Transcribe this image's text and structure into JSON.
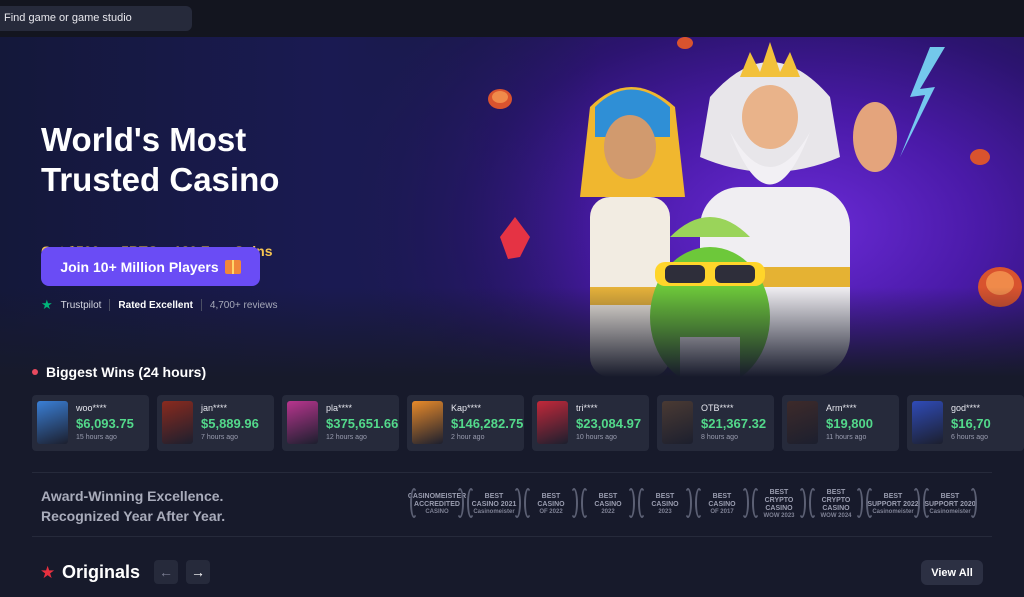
{
  "search": {
    "placeholder": "Find game or game studio"
  },
  "hero": {
    "title": "World's Most Trusted Casino",
    "subtitle": "Get $500 or 5BTC + 180 Free Spins",
    "cta_label": "Join 10+ Million Players",
    "trustpilot_label": "Trustpilot",
    "rating": "Rated Excellent",
    "reviews": "4,700+ reviews"
  },
  "biggest_wins": {
    "title": "Biggest Wins (24 hours)",
    "items": [
      {
        "player": "woo****",
        "amount": "$6,093.75",
        "time": "15 hours ago",
        "color": "#3a7fd6"
      },
      {
        "player": "jan****",
        "amount": "$5,889.96",
        "time": "7 hours ago",
        "color": "#8a2a1e"
      },
      {
        "player": "pla****",
        "amount": "$375,651.66",
        "time": "12 hours ago",
        "color": "#b8358e"
      },
      {
        "player": "Kap****",
        "amount": "$146,282.75",
        "time": "2 hour ago",
        "color": "#e88a2a"
      },
      {
        "player": "tri****",
        "amount": "$23,084.97",
        "time": "10 hours ago",
        "color": "#c2283a"
      },
      {
        "player": "OTB****",
        "amount": "$21,367.32",
        "time": "8 hours ago",
        "color": "#4a3a33"
      },
      {
        "player": "Arm****",
        "amount": "$19,800",
        "time": "11 hours ago",
        "color": "#3d2a2a"
      },
      {
        "player": "god****",
        "amount": "$16,70",
        "time": "6 hours ago",
        "color": "#2f4bb8"
      }
    ]
  },
  "awards": {
    "line1": "Award-Winning Excellence.",
    "line2": "Recognized Year After Year.",
    "badges": [
      {
        "l1": "CASINOMEISTER",
        "l2": "ACCREDITED",
        "l3": "CASINO"
      },
      {
        "l1": "BEST",
        "l2": "CASINO 2021",
        "l3": "Casinomeister"
      },
      {
        "l1": "BEST",
        "l2": "CASINO",
        "l3": "OF 2022"
      },
      {
        "l1": "BEST",
        "l2": "CASINO",
        "l3": "2022"
      },
      {
        "l1": "BEST",
        "l2": "CASINO",
        "l3": "2023"
      },
      {
        "l1": "BEST",
        "l2": "CASINO",
        "l3": "OF 2017"
      },
      {
        "l1": "BEST",
        "l2": "CRYPTO CASINO",
        "l3": "WOW 2023"
      },
      {
        "l1": "BEST",
        "l2": "CRYPTO CASINO",
        "l3": "WOW 2024"
      },
      {
        "l1": "BEST",
        "l2": "SUPPORT 2022",
        "l3": "Casinomeister"
      },
      {
        "l1": "BEST",
        "l2": "SUPPORT 2020",
        "l3": "Casinomeister"
      }
    ]
  },
  "originals": {
    "title": "Originals",
    "view_all": "View All"
  }
}
